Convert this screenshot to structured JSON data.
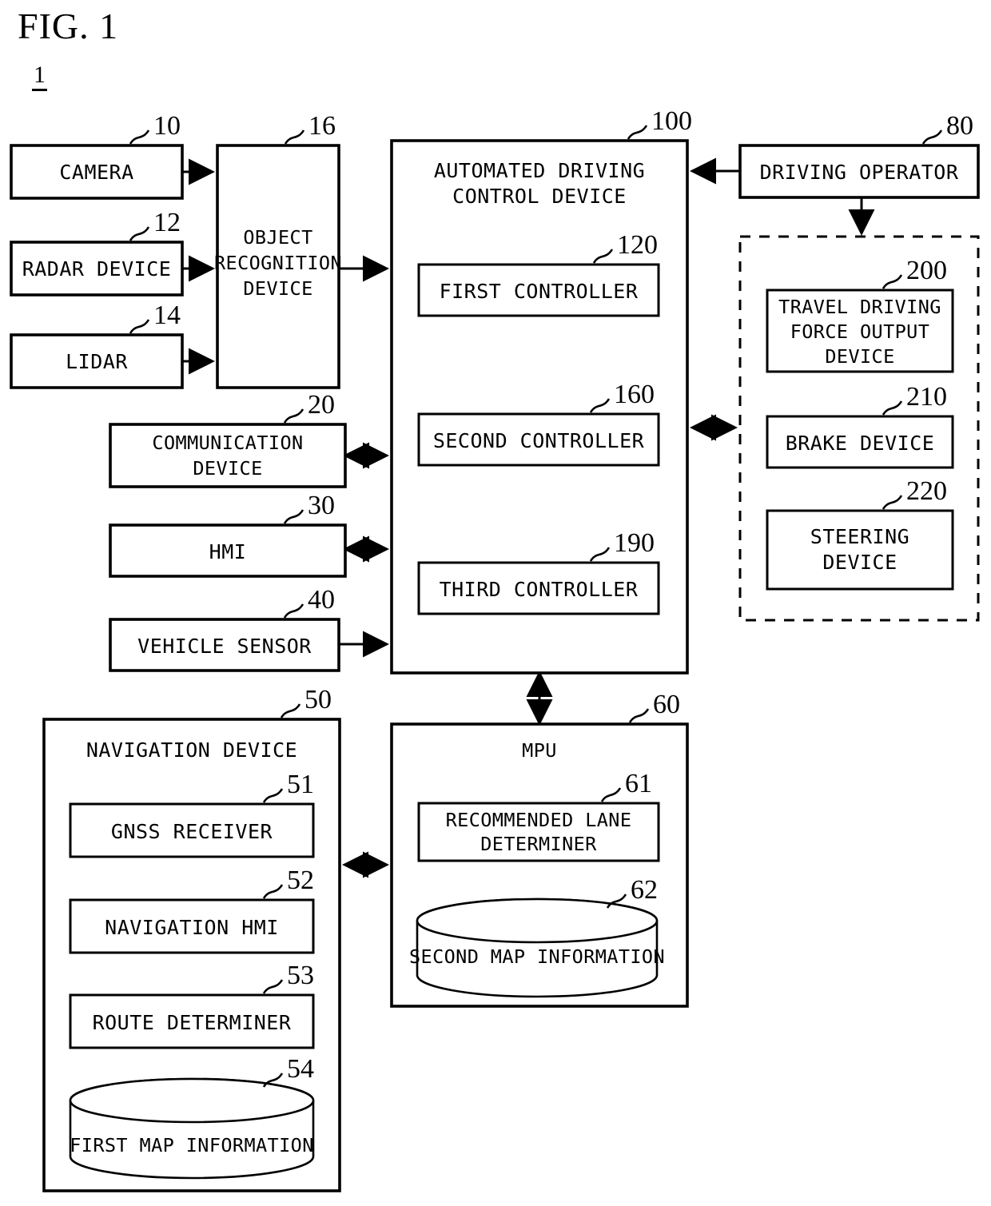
{
  "figure": {
    "title": "FIG. 1",
    "system_number": "1"
  },
  "nodes": {
    "camera": {
      "label": "CAMERA",
      "ref": "10"
    },
    "radar": {
      "label": "RADAR DEVICE",
      "ref": "12"
    },
    "lidar": {
      "label": "LIDAR",
      "ref": "14"
    },
    "object_recognition": {
      "line1": "OBJECT",
      "line2": "RECOGNITION",
      "line3": "DEVICE",
      "ref": "16"
    },
    "communication": {
      "line1": "COMMUNICATION",
      "line2": "DEVICE",
      "ref": "20"
    },
    "hmi": {
      "label": "HMI",
      "ref": "30"
    },
    "vehicle_sensor": {
      "label": "VEHICLE SENSOR",
      "ref": "40"
    },
    "navigation_device": {
      "label": "NAVIGATION DEVICE",
      "ref": "50"
    },
    "gnss_receiver": {
      "label": "GNSS RECEIVER",
      "ref": "51"
    },
    "navigation_hmi": {
      "label": "NAVIGATION HMI",
      "ref": "52"
    },
    "route_determiner": {
      "label": "ROUTE DETERMINER",
      "ref": "53"
    },
    "first_map_info": {
      "label": "FIRST MAP INFORMATION",
      "ref": "54"
    },
    "mpu": {
      "label": "MPU",
      "ref": "60"
    },
    "recommended_lane": {
      "line1": "RECOMMENDED LANE",
      "line2": "DETERMINER",
      "ref": "61"
    },
    "second_map_info": {
      "label": "SECOND MAP INFORMATION",
      "ref": "62"
    },
    "driving_operator": {
      "label": "DRIVING OPERATOR",
      "ref": "80"
    },
    "adcd": {
      "line1": "AUTOMATED DRIVING",
      "line2": "CONTROL DEVICE",
      "ref": "100"
    },
    "first_controller": {
      "label": "FIRST CONTROLLER",
      "ref": "120"
    },
    "second_controller": {
      "label": "SECOND CONTROLLER",
      "ref": "160"
    },
    "third_controller": {
      "label": "THIRD CONTROLLER",
      "ref": "190"
    },
    "travel_driving_force": {
      "line1": "TRAVEL DRIVING",
      "line2": "FORCE OUTPUT",
      "line3": "DEVICE",
      "ref": "200"
    },
    "brake_device": {
      "label": "BRAKE DEVICE",
      "ref": "210"
    },
    "steering_device": {
      "line1": "STEERING",
      "line2": "DEVICE",
      "ref": "220"
    }
  },
  "style": {
    "ink": "#000000",
    "paper": "#ffffff"
  }
}
